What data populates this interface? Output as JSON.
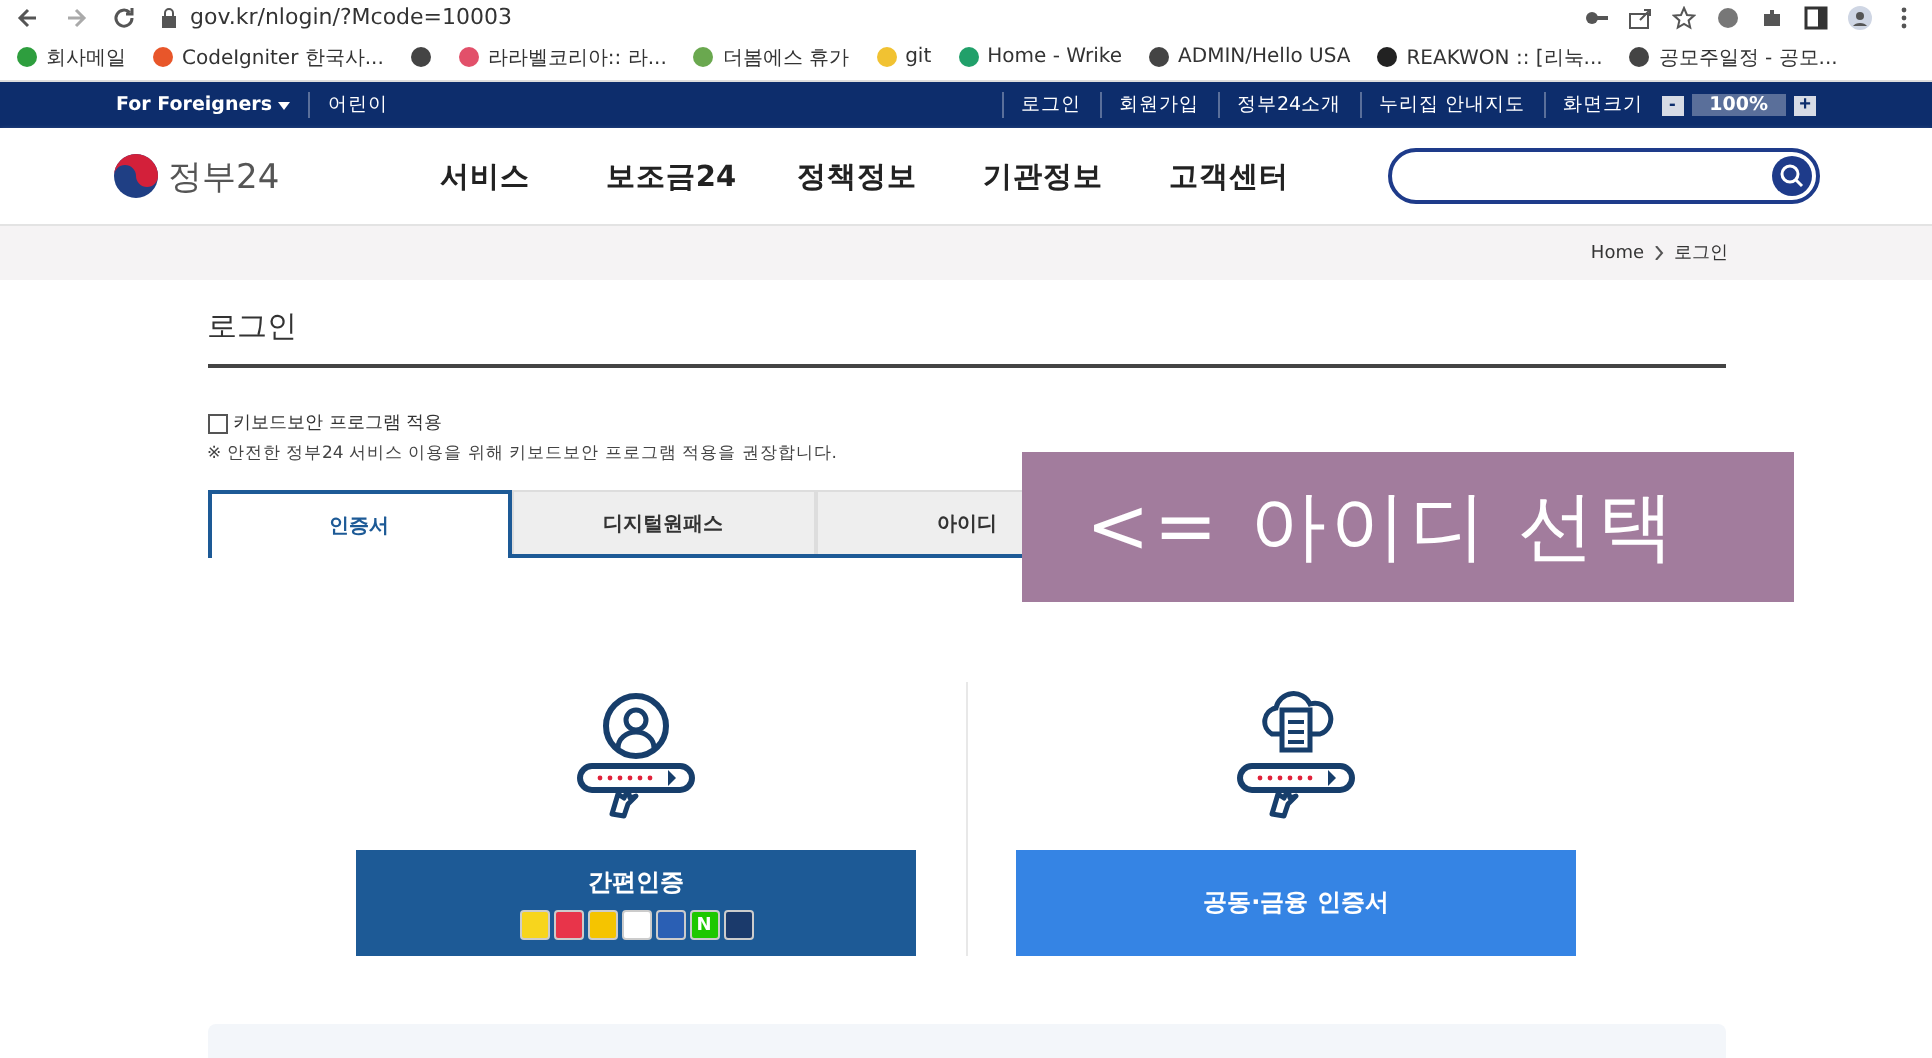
{
  "browser": {
    "url": "gov.kr/nlogin/?Mcode=10003",
    "bookmarks": [
      {
        "kind": "link",
        "label": "회사메일",
        "color": "#2e9e3e"
      },
      {
        "kind": "link",
        "label": "CodeIgniter 한국사...",
        "color": "#e8562a"
      },
      {
        "kind": "icon",
        "color": "#444444"
      },
      {
        "kind": "link",
        "label": "라라벨코리아:: 라...",
        "color": "#e2506a"
      },
      {
        "kind": "link",
        "label": "더봄에스 휴가",
        "color": "#6aa84f"
      },
      {
        "kind": "link",
        "label": "git",
        "color": "#f1c232"
      },
      {
        "kind": "link",
        "label": "Home - Wrike",
        "color": "#21a06a"
      },
      {
        "kind": "link",
        "label": "ADMIN/Hello USA",
        "color": "#444444"
      },
      {
        "kind": "link",
        "label": "REAKWON :: [리눅...",
        "color": "#222222"
      },
      {
        "kind": "link",
        "label": "공모주일정 - 공모...",
        "color": "#444444"
      }
    ]
  },
  "utility_bar": {
    "left": [
      "For Foreigners",
      "어린이"
    ],
    "right": [
      "로그인",
      "회원가입",
      "정부24소개",
      "누리집 안내지도",
      "화면크기"
    ],
    "zoom": {
      "minus": "-",
      "value": "100%",
      "plus": "+"
    }
  },
  "header": {
    "logo": "정부24",
    "nav": [
      "서비스",
      "보조금24",
      "정책정보",
      "기관정보",
      "고객센터"
    ]
  },
  "breadcrumb": [
    "Home",
    "로그인"
  ],
  "page_title": "로그인",
  "keyboard_security": {
    "label": "키보드보안 프로그램 적용",
    "checked": false
  },
  "notice": "※ 안전한 정부24 서비스 이용을 위해 키보드보안 프로그램 적용을 권장합니다.",
  "tabs": [
    {
      "label": "인증서",
      "selected": true
    },
    {
      "label": "디지털원패스",
      "selected": false
    },
    {
      "label": "아이디",
      "selected": false
    }
  ],
  "methods": [
    {
      "kind": "simple",
      "title": "간편인증",
      "providers": [
        {
          "color": "#f7d51d"
        },
        {
          "color": "#e8344a"
        },
        {
          "color": "#f5c400"
        },
        {
          "color": "#ffffff"
        },
        {
          "color": "#2a5fb4"
        },
        {
          "color": "#1ec800",
          "text": "N"
        },
        {
          "color": "#1b3a6b"
        }
      ]
    },
    {
      "kind": "joint",
      "title": "공동·금융 인증서"
    }
  ],
  "annotation": {
    "text": "<= 아이디 선택"
  }
}
